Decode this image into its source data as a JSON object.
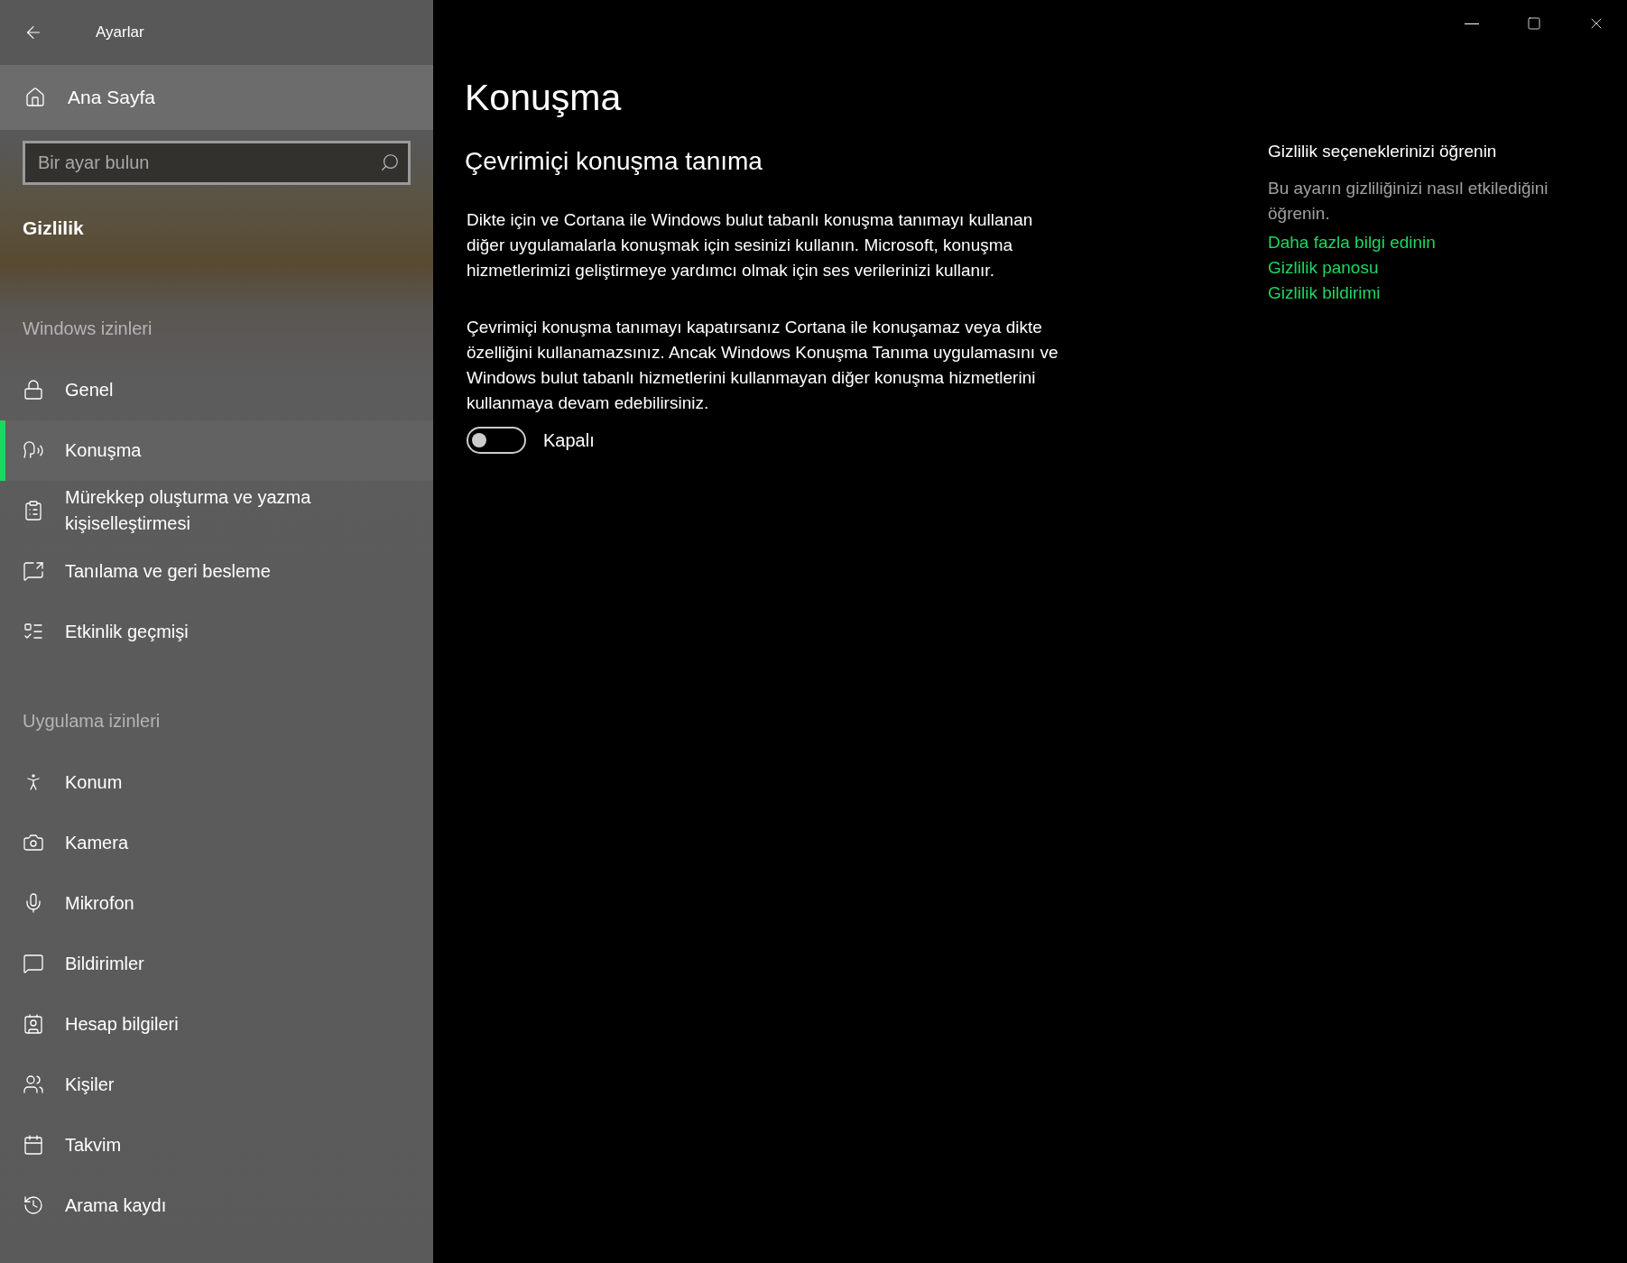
{
  "window": {
    "title": "Ayarlar"
  },
  "sidebar": {
    "home": "Ana Sayfa",
    "search": {
      "placeholder": "Bir ayar bulun"
    },
    "category": "Gizlilik",
    "sections": [
      {
        "heading": "Windows izinleri",
        "items": [
          {
            "label": "Genel",
            "selected": false
          },
          {
            "label": "Konuşma",
            "selected": true
          },
          {
            "label": "Mürekkep oluşturma ve yazma kişiselleştirmesi",
            "selected": false
          },
          {
            "label": "Tanılama ve geri besleme",
            "selected": false
          },
          {
            "label": "Etkinlik geçmişi",
            "selected": false
          }
        ]
      },
      {
        "heading": "Uygulama izinleri",
        "items": [
          {
            "label": "Konum",
            "selected": false
          },
          {
            "label": "Kamera",
            "selected": false
          },
          {
            "label": "Mikrofon",
            "selected": false
          },
          {
            "label": "Bildirimler",
            "selected": false
          },
          {
            "label": "Hesap bilgileri",
            "selected": false
          },
          {
            "label": "Kişiler",
            "selected": false
          },
          {
            "label": "Takvim",
            "selected": false
          },
          {
            "label": "Arama kaydı",
            "selected": false
          }
        ]
      }
    ]
  },
  "main": {
    "title": "Konuşma",
    "subtitle": "Çevrimiçi konuşma tanıma",
    "paragraphs": [
      "Dikte için ve Cortana ile Windows bulut tabanlı konuşma tanımayı kullanan diğer uygulamalarla konuşmak için sesinizi kullanın. Microsoft, konuşma hizmetlerimizi geliştirmeye yardımcı olmak için ses verilerinizi kullanır.",
      "Çevrimiçi konuşma tanımayı kapatırsanız Cortana ile konuşamaz veya dikte özelliğini kullanamazsınız. Ancak Windows Konuşma Tanıma uygulamasını ve Windows bulut tabanlı hizmetlerini kullanmayan diğer konuşma hizmetlerini kullanmaya devam edebilirsiniz."
    ],
    "toggle": {
      "on": false,
      "label": "Kapalı"
    }
  },
  "aside": {
    "heading": "Gizlilik seçeneklerinizi öğrenin",
    "text": "Bu ayarın gizliliğinizi nasıl etkilediğini öğrenin.",
    "links": [
      "Daha fazla bilgi edinin",
      "Gizlilik panosu",
      "Gizlilik bildirimi"
    ]
  }
}
